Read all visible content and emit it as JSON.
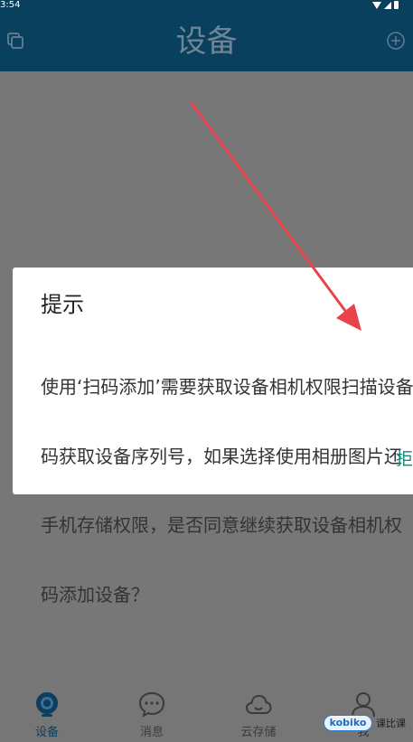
{
  "status_bar": {
    "time": "3:54",
    "icons": [
      "wifi-icon",
      "signal-icon",
      "battery-icon"
    ]
  },
  "header": {
    "title": "设备",
    "left_icon": "copy-icon",
    "right_icon": "add-circle-icon"
  },
  "dialog": {
    "title": "提示",
    "message": "使用‘扫码添加’需要获取设备相机权限扫描设备二维码获取设备序列号，如果选择使用相册图片还需要获取手机存储权限，是否同意继续获取设备相机权限进行扫码添加设备？",
    "message_lines": [
      "使用‘扫码添加’需要获取设备相机权限扫描设备",
      "码获取设备序列号，如果选择使用相册图片还",
      "手机存储权限，是否同意继续获取设备相机权",
      "码添加设备？"
    ],
    "refuse_label": "拒"
  },
  "bottom_nav": {
    "items": [
      {
        "label": "设备",
        "icon": "camera-icon",
        "active": true
      },
      {
        "label": "消息",
        "icon": "message-icon",
        "active": false
      },
      {
        "label": "云存储",
        "icon": "cloud-icon",
        "active": false
      },
      {
        "label": "我",
        "icon": "person-icon",
        "active": false
      }
    ]
  },
  "watermark": {
    "brand": "kobiko",
    "text": "课比课"
  },
  "colors": {
    "header_bg": "#08405e",
    "overlay": "#777777",
    "accent_teal": "#17877a",
    "active_nav": "#0c3e5e",
    "arrow": "#e8434b"
  }
}
